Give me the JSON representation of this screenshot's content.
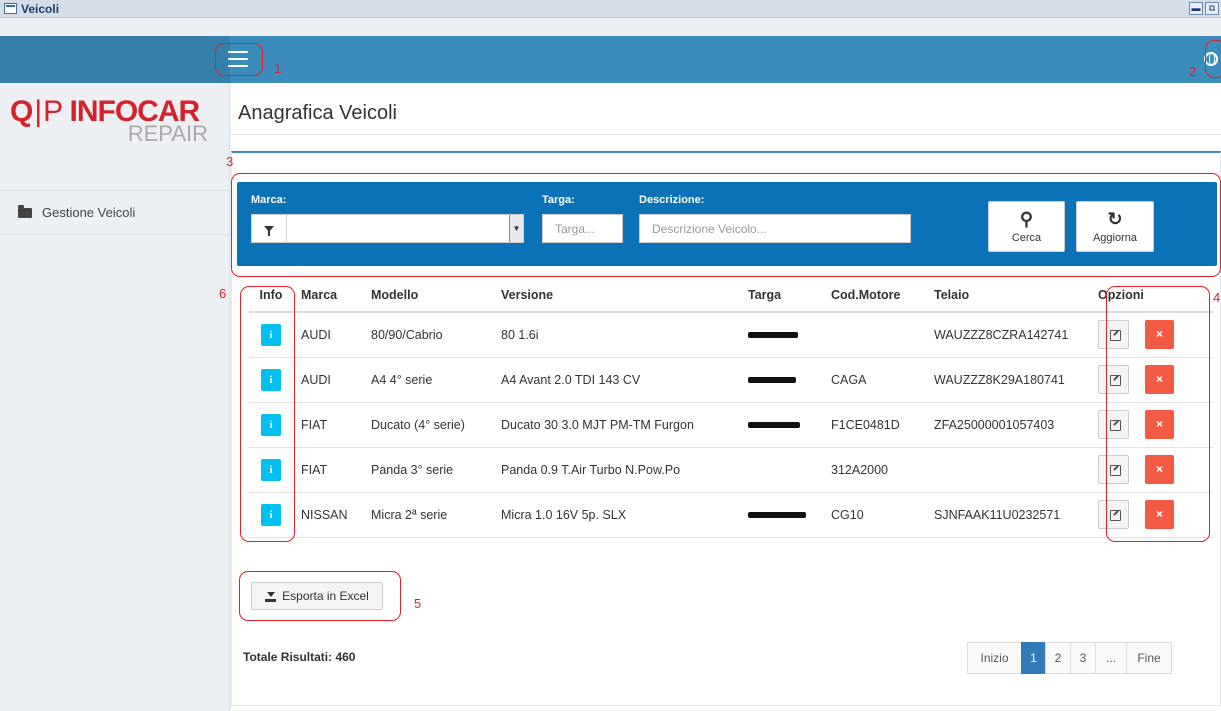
{
  "window": {
    "title": "Veicoli",
    "btn_min": "▬",
    "btn_restore": "⧉"
  },
  "sidebar": {
    "logo": {
      "qp_left": "Q",
      "qp_sep": "|",
      "qp_right": "P",
      "brand": "INFOCAR",
      "sub": "REPAIR"
    },
    "items": [
      {
        "label": "Gestione Veicoli",
        "icon": "folder-icon"
      }
    ]
  },
  "page": {
    "title": "Anagrafica Veicoli"
  },
  "filters": {
    "marca_label": "Marca:",
    "targa_label": "Targa:",
    "targa_placeholder": "Targa...",
    "descrizione_label": "Descrizione:",
    "descrizione_placeholder": "Descrizione Veicolo...",
    "search_label": "Cerca",
    "refresh_label": "Aggiorna",
    "dropdown_arrow": "▼"
  },
  "table": {
    "headers": {
      "info": "Info",
      "marca": "Marca",
      "modello": "Modello",
      "versione": "Versione",
      "targa": "Targa",
      "motore": "Cod.Motore",
      "telaio": "Telaio",
      "opzioni": "Opzioni"
    },
    "info_glyph": "i",
    "delete_glyph": "×",
    "rows": [
      {
        "marca": "AUDI",
        "modello": "80/90/Cabrio",
        "versione": "80 1.6i",
        "targa": "",
        "motore": "",
        "telaio": "WAUZZZ8CZRA142741"
      },
      {
        "marca": "AUDI",
        "modello": "A4 4° serie",
        "versione": "A4 Avant 2.0 TDI 143 CV",
        "targa": "",
        "motore": "CAGA",
        "telaio": "WAUZZZ8K29A180741"
      },
      {
        "marca": "FIAT",
        "modello": "Ducato (4° serie)",
        "versione": "Ducato 30 3.0 MJT PM-TM Furgon",
        "targa": "",
        "motore": "F1CE0481D",
        "telaio": "ZFA25000001057403"
      },
      {
        "marca": "FIAT",
        "modello": "Panda 3° serie",
        "versione": "Panda 0.9 T.Air Turbo N.Pow.Po",
        "targa": "",
        "motore": "312A2000",
        "telaio": ""
      },
      {
        "marca": "NISSAN",
        "modello": "Micra 2ª serie",
        "versione": "Micra 1.0 16V 5p. SLX",
        "targa": "",
        "motore": "CG10",
        "telaio": "SJNFAAK11U0232571"
      }
    ]
  },
  "export": {
    "label": "Esporta in Excel"
  },
  "totals": {
    "label": "Totale Risultati: 460"
  },
  "pagination": {
    "first": "Inizio",
    "pages": [
      "1",
      "2",
      "3"
    ],
    "ellipsis": "...",
    "last": "Fine",
    "active": "1"
  },
  "annotations": [
    "1",
    "2",
    "3",
    "4",
    "5",
    "6"
  ],
  "colors": {
    "header": "#3c8dbc",
    "filter_bar": "#0c72b8",
    "info_button": "#00c0ef",
    "delete_button": "#f15a44",
    "annotation": "#e2202b",
    "logo_red": "#d2232a"
  }
}
